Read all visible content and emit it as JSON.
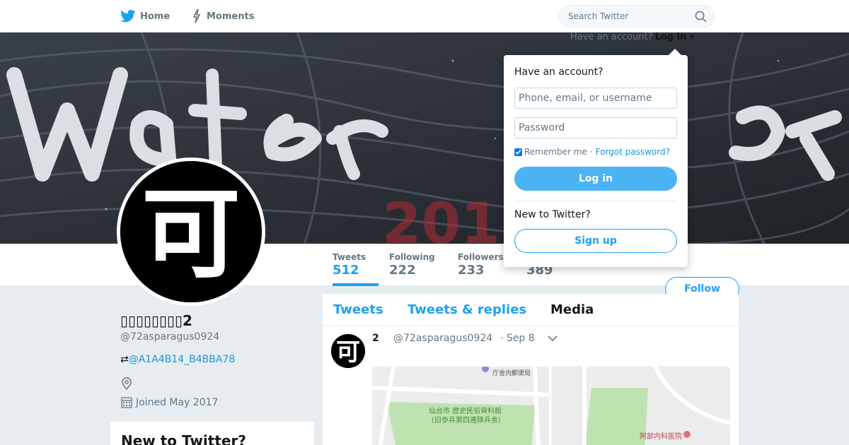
{
  "colors": {
    "accent": "#1da1f2",
    "link": "#1b95e0",
    "text_primary": "#14171a",
    "text_secondary": "#657786",
    "page_bg": "#e6ecf0"
  },
  "topnav": {
    "home_label": "Home",
    "home_icon": "twitter-bird-icon",
    "moments_label": "Moments",
    "moments_icon": "lightning-icon",
    "search_placeholder": "Search Twitter",
    "search_icon": "search-icon"
  },
  "banner": {
    "painted_text": "Water Day",
    "year_text": "2018"
  },
  "profile": {
    "avatar_glyph": "可",
    "name": "▯▯▯▯▯▯▯▯2",
    "handle": "@72asparagus0924",
    "link_prefix": "⇄",
    "link_text": "@A1A4B14_B4BBA78",
    "joined": "Joined May 2017"
  },
  "stats": [
    {
      "label": "Tweets",
      "value": "512"
    },
    {
      "label": "Following",
      "value": "222"
    },
    {
      "label": "Followers",
      "value": "233"
    },
    {
      "label": "",
      "value": "389"
    }
  ],
  "follow_label": "Follow",
  "signup_card": {
    "title": "New to Twitter?"
  },
  "timeline": {
    "tabs": [
      "Tweets",
      "Tweets & replies",
      "Media"
    ],
    "active_tab": "Media",
    "tweet": {
      "name": "2",
      "handle": "@72asparagus0924",
      "time": "· Sep 8",
      "map_labels": [
        "庁舎内郵便局",
        "仙台市 歴史民俗資料館",
        "(旧歩兵第四連隊兵舎)",
        "阿部内科医院"
      ]
    }
  },
  "login": {
    "have_account": "Have an account?",
    "login_link": "Log in",
    "title": "Have an account?",
    "username_placeholder": "Phone, email, or username",
    "password_placeholder": "Password",
    "remember": "Remember me",
    "separator": "·",
    "forgot": "Forgot password?",
    "login_button": "Log in",
    "new_to": "New to Twitter?",
    "signup_button": "Sign up"
  }
}
